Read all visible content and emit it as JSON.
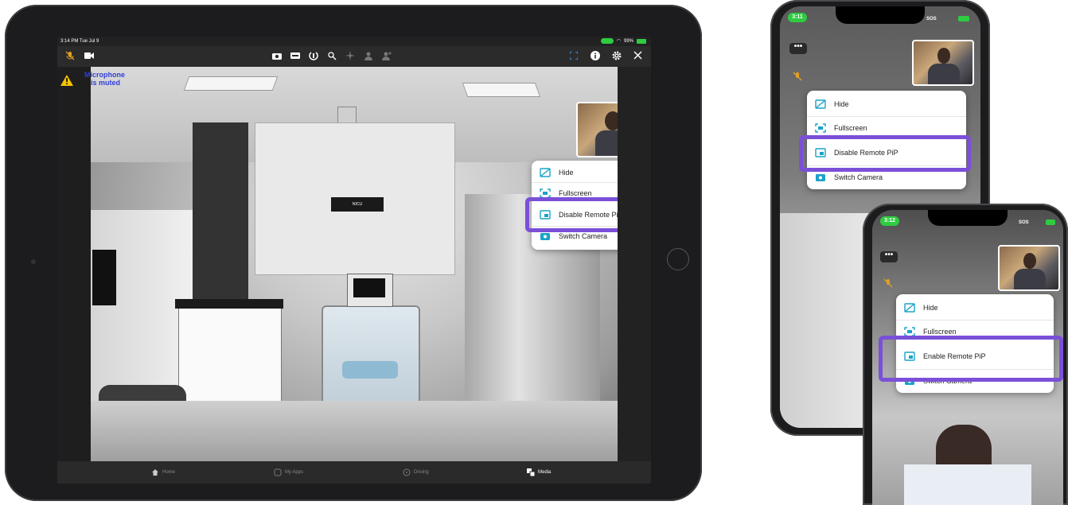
{
  "colors": {
    "highlight": "#7b4fd8",
    "menu_icon": "#1aa3c8",
    "status_green": "#2ecc40",
    "warning": "#f5c400",
    "mic_muted_text": "#2f3fd6"
  },
  "ipad": {
    "status_bar": {
      "time_date": "3:14 PM  Tue Jul 9",
      "battery": "99%"
    },
    "toolbar": {
      "left_icons": [
        "mic-muted-icon",
        "video-icon"
      ],
      "center_icons": [
        "camera-icon",
        "keyboard-icon",
        "rotate-icon",
        "pointer-icon",
        "sparkle-icon",
        "person-scan-icon",
        "add-person-icon"
      ],
      "right_icons": [
        "pip-icon",
        "info-icon",
        "gear-icon",
        "close-icon"
      ]
    },
    "warning_text_line1": "Microphone",
    "warning_text_line2": "is muted",
    "scene_sign": "NICU",
    "pip_menu": {
      "items": [
        {
          "label": "Hide",
          "icon": "hide-icon"
        },
        {
          "label": "Fullscreen",
          "icon": "fullscreen-icon"
        },
        {
          "label": "Disable Remote PiP",
          "icon": "pip-toggle-icon"
        },
        {
          "label": "Switch Camera",
          "icon": "switch-camera-icon"
        }
      ],
      "highlighted_index": 2
    },
    "tabs": [
      {
        "label": "Home",
        "icon": "home-icon",
        "active": false
      },
      {
        "label": "My Apps",
        "icon": "apps-icon",
        "active": false
      },
      {
        "label": "Driving",
        "icon": "steering-icon",
        "active": false
      },
      {
        "label": "Media",
        "icon": "media-icon",
        "active": true
      }
    ]
  },
  "phone1": {
    "time": "3:11",
    "status_right": "SOS",
    "more_label": "•••",
    "pip_menu": {
      "items": [
        {
          "label": "Hide",
          "icon": "hide-icon"
        },
        {
          "label": "Fullscreen",
          "icon": "fullscreen-icon"
        },
        {
          "label": "Disable Remote PiP",
          "icon": "pip-toggle-icon"
        },
        {
          "label": "Switch Camera",
          "icon": "switch-camera-icon"
        }
      ],
      "highlighted_index": 2
    }
  },
  "phone2": {
    "time": "3:12",
    "status_right": "SOS",
    "more_label": "•••",
    "pip_menu": {
      "items": [
        {
          "label": "Hide",
          "icon": "hide-icon"
        },
        {
          "label": "Fullscreen",
          "icon": "fullscreen-icon"
        },
        {
          "label": "Enable Remote PiP",
          "icon": "pip-toggle-icon"
        },
        {
          "label": "Switch Camera",
          "icon": "switch-camera-icon"
        }
      ],
      "highlighted_index": 2
    }
  }
}
